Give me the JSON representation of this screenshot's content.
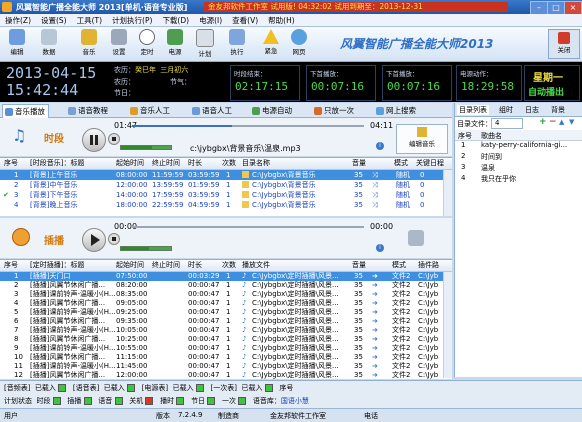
{
  "window": {
    "title": "风翼智能广播全能大师 2013[单机·语音专业版]",
    "banner": "金友邦软件工作室   试用版!   04:32:02 试用到期至：2013-12-31"
  },
  "menu": [
    "操作(Z)",
    "设置(S)",
    "工具(T)",
    "计划执行(P)",
    "下载(D)",
    "电源(I)",
    "查看(V)",
    "帮助(H)"
  ],
  "toolbar": {
    "buttons": [
      "编辑",
      "数据",
      "音乐",
      "设置",
      "定时",
      "电源",
      "计划",
      "",
      "执行",
      "紧急",
      "网页"
    ],
    "brand": "风翼智能广播全能大师2013",
    "close_label": "关闭"
  },
  "clock": {
    "date": "2013-04-15",
    "time": "15:42:44",
    "lunar_label": "农历：",
    "lunar_value": "癸巳年  三月初六",
    "solar_label": "农历：",
    "holiday_label": "节气：",
    "festival_label": "节日：",
    "timer1_label": "时段结束：",
    "timer1_value": "02:17:15",
    "timer2_label": "下首播放：",
    "timer2_value": "00:07:16",
    "timer3_label": "下首播放：",
    "timer3_value": "00:07:16",
    "timer4_label": "电源动作：",
    "timer4_value": "18:29:58",
    "weekday": "星期一",
    "auto_mode": "自动播出"
  },
  "tabs": [
    "音乐播放",
    "语音教程",
    "音乐人工",
    "语音人工",
    "电源自动",
    "只放一次",
    "网上搜索"
  ],
  "player1": {
    "label": "时段",
    "elapsed": "01:47",
    "total": "04:11",
    "file": "c:\\jybgbx\\背景音乐\\温泉.mp3",
    "edit_label": "编辑音乐",
    "progress": 0.43,
    "volume": 0.62
  },
  "table1": {
    "headers": [
      "序号",
      "[时段音乐]：标题",
      "起始时间",
      "终止时间",
      "时长",
      "次数",
      "目录名称",
      "",
      "音量",
      "模式",
      "关键日程"
    ],
    "rows": [
      [
        "1",
        "[背景]上午音乐",
        "08:00:00",
        "11:59:59",
        "03:59:59",
        "1",
        "C:\\Jybgbx\\背景音乐",
        "35",
        "随机",
        "0"
      ],
      [
        "2",
        "[背景]中午音乐",
        "12:00:00",
        "13:59:59",
        "01:59:59",
        "1",
        "C:\\Jybgbx\\背景音乐",
        "35",
        "随机",
        "0"
      ],
      [
        "3",
        "[背景]下午音乐",
        "14:00:00",
        "17:59:59",
        "03:59:59",
        "1",
        "C:\\Jybgbx\\背景音乐",
        "35",
        "随机",
        "0"
      ],
      [
        "4",
        "[背景]晚上音乐",
        "18:00:00",
        "22:59:59",
        "04:59:59",
        "1",
        "C:\\Jybgbx\\背景音乐",
        "35",
        "随机",
        "0"
      ]
    ]
  },
  "player2": {
    "label": "插播",
    "elapsed": "00:00",
    "total": "00:00",
    "progress": 0,
    "volume": 0.55
  },
  "table2": {
    "headers": [
      "序号",
      "[定时插播]：标题",
      "起始时间",
      "终止时间",
      "时长",
      "次数",
      "播放文件",
      "音量",
      "",
      "模式",
      "插件路"
    ],
    "rows": [
      [
        "1",
        "[插播]天门口",
        "07:50:00",
        "",
        "00:03:29",
        "1",
        "C:\\Jybgbx\\定时插播\\风景...",
        "35",
        "文件2",
        "C:\\Jyb"
      ],
      [
        "2",
        "[插播]风翼节休闲广播...",
        "08:20:00",
        "",
        "00:00:47",
        "1",
        "C:\\Jybgbx\\定时插播\\风景...",
        "35",
        "文件2",
        "C:\\Jyb"
      ],
      [
        "3",
        "[插播]课前铃声-温暖小(H...",
        "08:35:00",
        "",
        "00:00:47",
        "1",
        "C:\\Jybgbx\\定时插播\\风景...",
        "35",
        "文件2",
        "C:\\Jyb"
      ],
      [
        "4",
        "[插播]风翼节休闲广播...",
        "09:05:00",
        "",
        "00:00:47",
        "1",
        "C:\\Jybgbx\\定时插播\\风景...",
        "35",
        "文件2",
        "C:\\Jyb"
      ],
      [
        "5",
        "[插播]课前铃声-温暖小(H...",
        "09:25:00",
        "",
        "00:00:47",
        "1",
        "C:\\Jybgbx\\定时插播\\风景...",
        "35",
        "文件2",
        "C:\\Jyb"
      ],
      [
        "6",
        "[插播]风翼节休闲广播...",
        "09:35:00",
        "",
        "00:00:47",
        "1",
        "C:\\Jybgbx\\定时插播\\风景...",
        "35",
        "文件2",
        "C:\\Jyb"
      ],
      [
        "7",
        "[插播]课前铃声-温暖小(H...",
        "10:05:00",
        "",
        "00:00:47",
        "1",
        "C:\\Jybgbx\\定时插播\\风景...",
        "35",
        "文件2",
        "C:\\Jyb"
      ],
      [
        "8",
        "[插播]风翼节休闲广播...",
        "10:25:00",
        "",
        "00:00:47",
        "1",
        "C:\\Jybgbx\\定时插播\\风景...",
        "35",
        "文件2",
        "C:\\Jyb"
      ],
      [
        "9",
        "[插播]课前铃声-温暖小(H...",
        "10:55:00",
        "",
        "00:00:47",
        "1",
        "C:\\Jybgbx\\定时插播\\风景...",
        "35",
        "文件2",
        "C:\\Jyb"
      ],
      [
        "10",
        "[插播]风翼节休闲广播...",
        "11:15:00",
        "",
        "00:00:47",
        "1",
        "C:\\Jybgbx\\定时插播\\风景...",
        "35",
        "文件2",
        "C:\\Jyb"
      ],
      [
        "11",
        "[插播]课前铃声-温暖小(H...",
        "11:45:00",
        "",
        "00:00:47",
        "1",
        "C:\\Jybgbx\\定时插播\\风景...",
        "35",
        "文件2",
        "C:\\Jyb"
      ],
      [
        "12",
        "[插播]风翼节休闲广播...",
        "12:00:00",
        "",
        "00:00:47",
        "1",
        "C:\\Jybgbx\\定时插播\\风景...",
        "35",
        "文件2",
        "C:\\Jyb"
      ]
    ]
  },
  "right_panel": {
    "tabs": [
      "目录列表",
      "组时",
      "日志",
      "背景"
    ],
    "dir_label": "目录文件：",
    "dir_count": "4",
    "headers": [
      "序号",
      "歌曲名"
    ],
    "rows": [
      [
        "1",
        "katy-perry-california-gi..."
      ],
      [
        "2",
        "时间到"
      ],
      [
        "3",
        "温泉"
      ],
      [
        "4",
        "我只在乎你"
      ]
    ]
  },
  "bottom": {
    "line1": [
      "[音频表]",
      "已载入",
      "[语音表]",
      "已载入",
      "[电源表]",
      "已载入",
      "[一次表]",
      "已载入",
      "序号"
    ],
    "line2": [
      "计划状态",
      "时段",
      "插播",
      "语音",
      "关机",
      "播时",
      "节日",
      "一次",
      "语音库：",
      "国语小慧"
    ]
  },
  "status": {
    "user_label": "用户",
    "version_label": "版本",
    "version": "7.2.4.9",
    "vendor_label": "制造商",
    "vendor": "金友邦软件工作室",
    "phone_label": "电话"
  },
  "colors": {
    "accent": "#2f6fc4",
    "selected_row": "#3f8fe0",
    "led_green": "#4bdb4b",
    "title_red": "#c8321e"
  }
}
